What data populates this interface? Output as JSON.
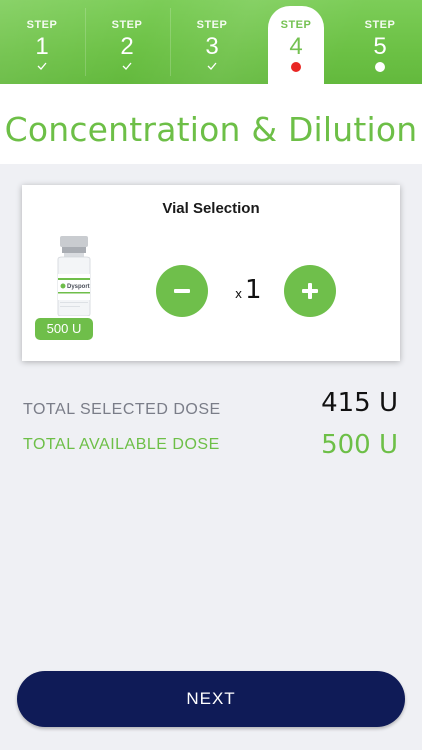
{
  "stepper": {
    "steps": [
      {
        "label": "STEP",
        "number": "1",
        "status": "complete"
      },
      {
        "label": "STEP",
        "number": "2",
        "status": "complete"
      },
      {
        "label": "STEP",
        "number": "3",
        "status": "complete"
      },
      {
        "label": "STEP",
        "number": "4",
        "status": "current",
        "indicator_color": "#e8201d"
      },
      {
        "label": "STEP",
        "number": "5",
        "status": "upcoming",
        "indicator_color": "#ffffff"
      }
    ],
    "colors": {
      "accent": "#6dbf47"
    }
  },
  "page": {
    "title": "Concentration & Dilution"
  },
  "vial_card": {
    "title": "Vial Selection",
    "vial_badge": "500 U",
    "vial_brand": "Dysport",
    "quantity_prefix": "x",
    "quantity": "1",
    "decrement_icon": "minus-icon",
    "increment_icon": "plus-icon"
  },
  "totals": {
    "selected_label": "TOTAL SELECTED DOSE",
    "selected_value": "415 U",
    "available_label": "TOTAL AVAILABLE DOSE",
    "available_value": "500 U"
  },
  "footer": {
    "next_label": "NEXT",
    "next_color": "#0f1b57"
  }
}
